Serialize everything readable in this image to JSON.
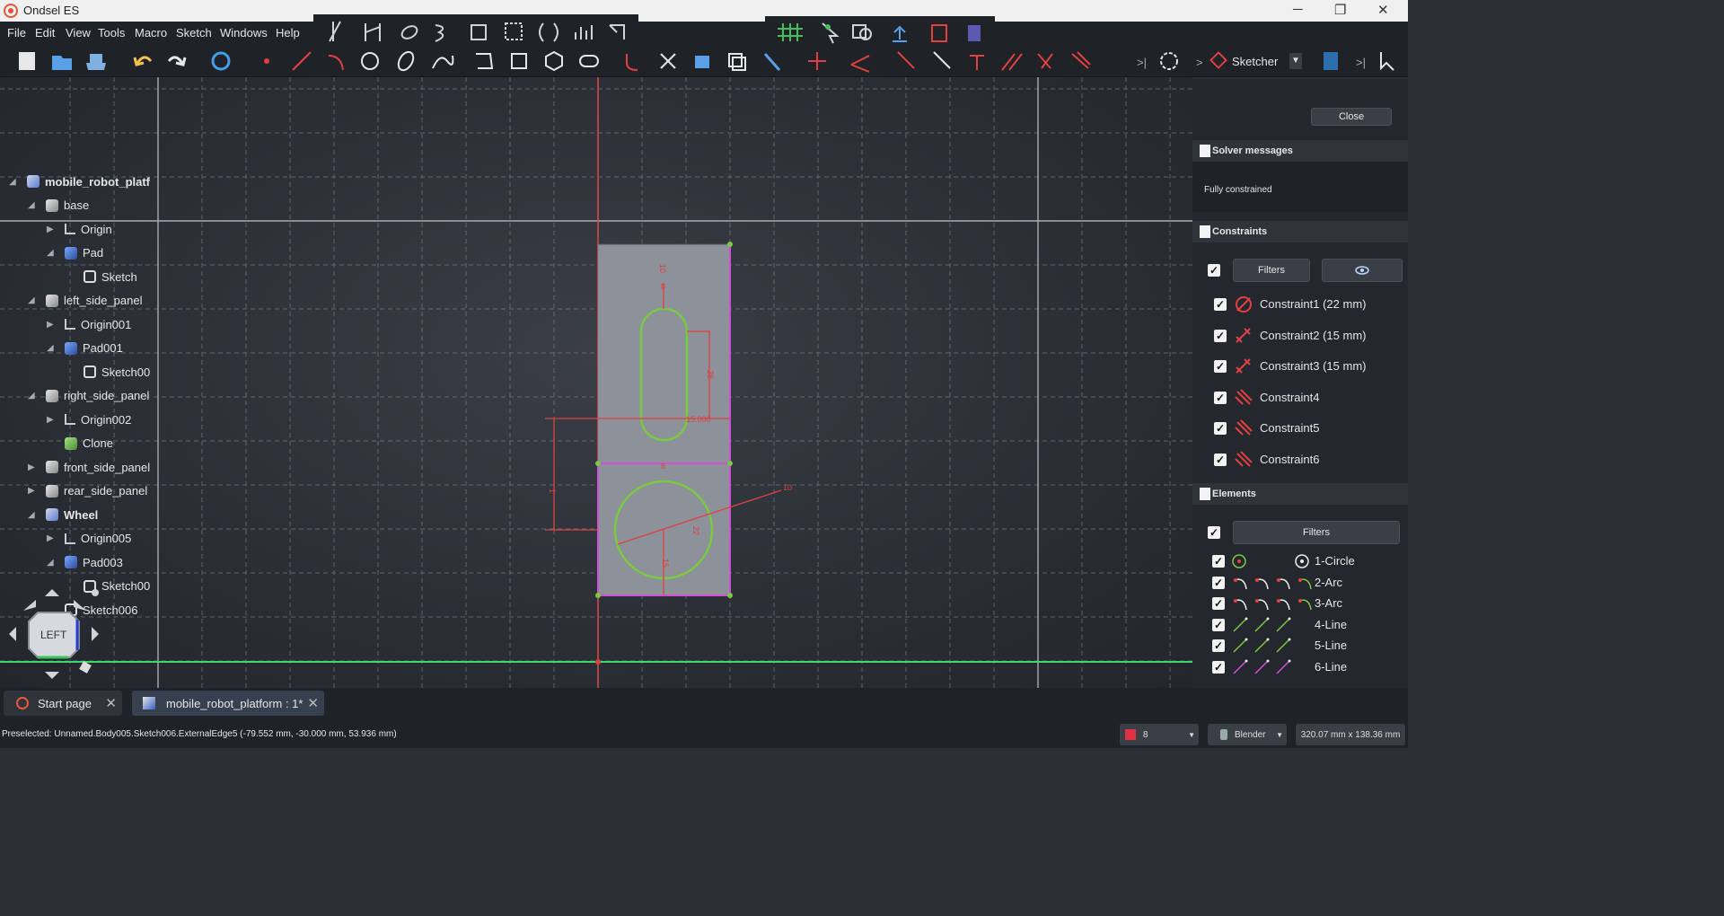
{
  "window": {
    "title": "Ondsel ES",
    "minimize": "─",
    "maximize": "❐",
    "close": "✕"
  },
  "menu": [
    "File",
    "Edit",
    "View",
    "Tools",
    "Macro",
    "Sketch",
    "Windows",
    "Help"
  ],
  "workbench": {
    "selected": "Sketcher"
  },
  "tree": [
    {
      "label": "mobile_robot_platf",
      "depth": 0,
      "icon": "body-icon",
      "expanded": true,
      "bold": true
    },
    {
      "label": "base",
      "depth": 1,
      "icon": "part-icon",
      "expanded": true
    },
    {
      "label": "Origin",
      "depth": 2,
      "icon": "origin-icon",
      "expanded": false
    },
    {
      "label": "Pad",
      "depth": 2,
      "icon": "pad-icon",
      "expanded": true
    },
    {
      "label": "Sketch",
      "depth": 3,
      "icon": "sketch-icon"
    },
    {
      "label": "left_side_panel",
      "depth": 1,
      "icon": "part-icon",
      "expanded": true
    },
    {
      "label": "Origin001",
      "depth": 2,
      "icon": "origin-icon",
      "expanded": false
    },
    {
      "label": "Pad001",
      "depth": 2,
      "icon": "pad-icon",
      "expanded": true
    },
    {
      "label": "Sketch00",
      "depth": 3,
      "icon": "sketch-icon"
    },
    {
      "label": "right_side_panel",
      "depth": 1,
      "icon": "part-icon",
      "expanded": true
    },
    {
      "label": "Origin002",
      "depth": 2,
      "icon": "origin-icon",
      "expanded": false
    },
    {
      "label": "Clone",
      "depth": 2,
      "icon": "clone-icon"
    },
    {
      "label": "front_side_panel",
      "depth": 1,
      "icon": "part-icon",
      "expanded": false
    },
    {
      "label": "rear_side_panel",
      "depth": 1,
      "icon": "part-icon",
      "expanded": false
    },
    {
      "label": "Wheel",
      "depth": 1,
      "icon": "body-icon",
      "expanded": true,
      "bold": true
    },
    {
      "label": "Origin005",
      "depth": 2,
      "icon": "origin-icon",
      "expanded": false
    },
    {
      "label": "Pad003",
      "depth": 2,
      "icon": "pad-icon",
      "expanded": true
    },
    {
      "label": "Sketch00",
      "depth": 3,
      "icon": "sketch-icon"
    },
    {
      "label": "Sketch006",
      "depth": 2,
      "icon": "sketch-icon"
    }
  ],
  "navcube": {
    "face": "LEFT"
  },
  "panel": {
    "close_label": "Close",
    "solver_title": "Solver messages",
    "solver_message": "Fully constrained",
    "constraints_title": "Constraints",
    "filters_label": "Filters",
    "constraints": [
      "Constraint1 (22 mm)",
      "Constraint2 (15 mm)",
      "Constraint3 (15 mm)",
      "Constraint4",
      "Constraint5",
      "Constraint6"
    ],
    "elements_title": "Elements",
    "elements": [
      "1-Circle",
      "2-Arc",
      "3-Arc",
      "4-Line",
      "5-Line",
      "6-Line"
    ]
  },
  "tabs": [
    {
      "label": "Start page",
      "active": false
    },
    {
      "label": "mobile_robot_platform : 1*",
      "active": true
    }
  ],
  "status": {
    "preselected": "Preselected: Unnamed.Body005.Sketch006.ExternalEdge5 (-79.552 mm, -30.000 mm, 53.936 mm)",
    "render_value": "8",
    "nav_style": "Blender",
    "dimensions": "320.07 mm x 138.36 mm"
  },
  "sketch": {
    "dims": [
      "10",
      "8",
      "28",
      "15.000",
      "8",
      "22",
      "15",
      "1",
      "10"
    ]
  },
  "colors": {
    "accent": "#e8553b",
    "grid": "#8a8e96",
    "constraint": "#e04040",
    "geometry": "#7ac943",
    "selection": "#d34fd3"
  }
}
